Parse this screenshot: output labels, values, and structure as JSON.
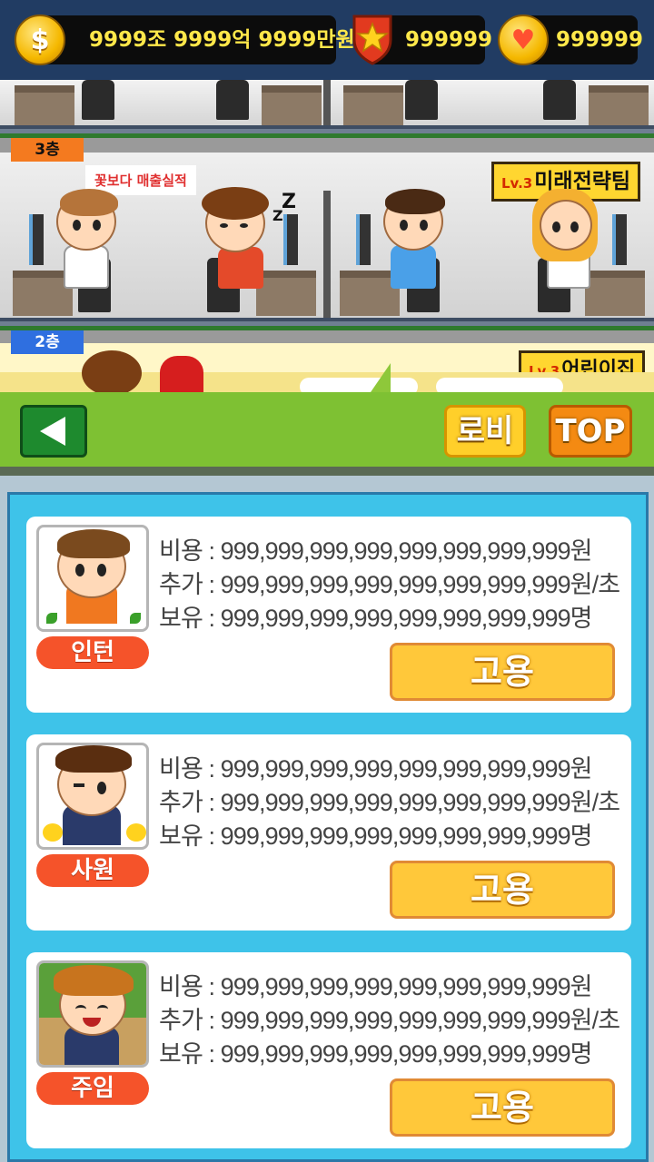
{
  "currency": {
    "gold": "9999조 9999억 9999만원",
    "medal": "999999",
    "heart": "999999",
    "gold_icon": "dollar-coin-icon",
    "medal_icon": "star-shield-icon",
    "heart_icon": "heart-coin-icon"
  },
  "floors": [
    {
      "label": "3층",
      "team_level": "Lv.3",
      "team_name": "미래전략팀",
      "speech": "꽃보다 매출실적",
      "badge_color": "#f47a1f"
    },
    {
      "label": "2층",
      "team_level": "Lv.3",
      "team_name": "어린이집",
      "badge_color": "#2f6fe0"
    }
  ],
  "sleep_text": "Z",
  "nav": {
    "back_icon": "back-arrow-icon",
    "lobby_label": "로비",
    "top_label": "TOP"
  },
  "hire_cards": [
    {
      "rank": "인턴",
      "cost": "비용 : 999,999,999,999,999,999,999,999원",
      "extra": "추가 : 999,999,999,999,999,999,999,999원/초",
      "owned": "보유 : 999,999,999,999,999,999,999,999명",
      "hire_label": "고용"
    },
    {
      "rank": "사원",
      "cost": "비용 : 999,999,999,999,999,999,999,999원",
      "extra": "추가 : 999,999,999,999,999,999,999,999원/초",
      "owned": "보유 : 999,999,999,999,999,999,999,999명",
      "hire_label": "고용"
    },
    {
      "rank": "주임",
      "cost": "비용 : 999,999,999,999,999,999,999,999원",
      "extra": "추가 : 999,999,999,999,999,999,999,999원/초",
      "owned": "보유 : 999,999,999,999,999,999,999,999명",
      "hire_label": "고용"
    }
  ],
  "colors": {
    "nav_green": "#7ec133",
    "panel_blue": "#3ec3e9",
    "hire_button": "#ffc83a",
    "rank_tag": "#f5532a"
  }
}
